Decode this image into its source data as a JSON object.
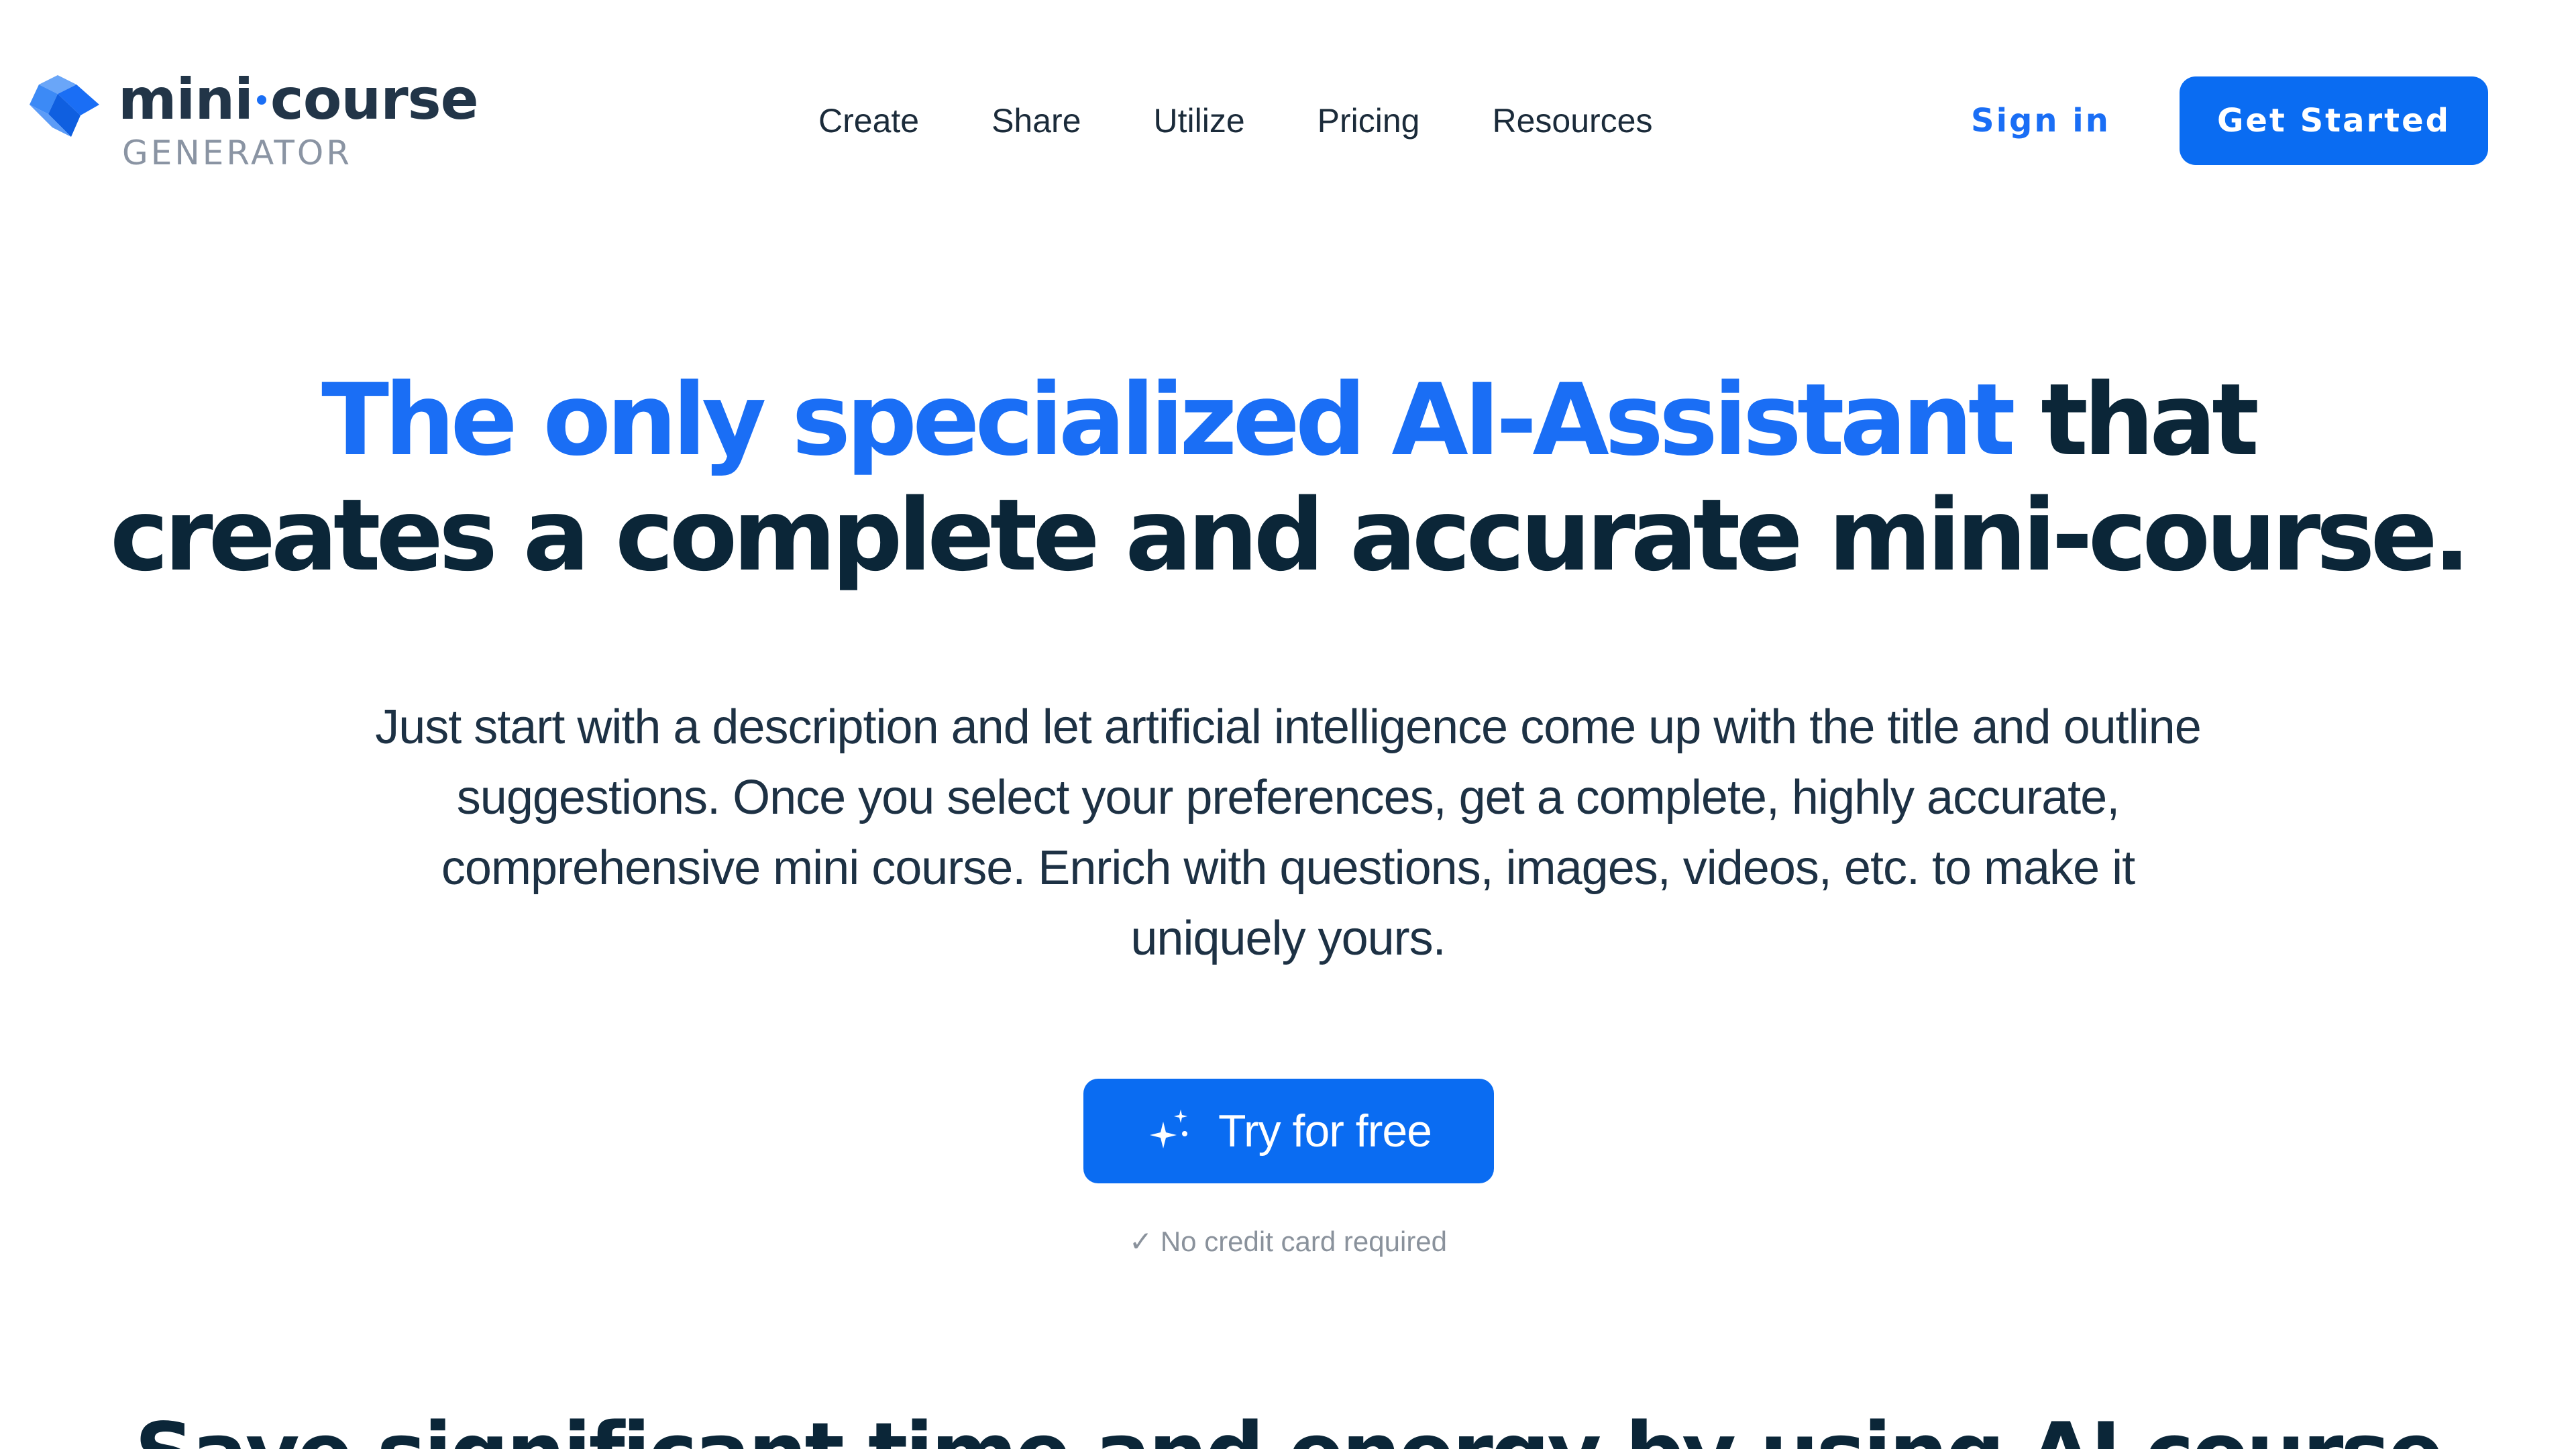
{
  "brand": {
    "name_left": "mini",
    "name_right": "course",
    "subtitle": "GENERATOR",
    "logo_icon": "diamond-logo-icon"
  },
  "nav": {
    "items": [
      {
        "label": "Create"
      },
      {
        "label": "Share"
      },
      {
        "label": "Utilize"
      },
      {
        "label": "Pricing"
      },
      {
        "label": "Resources"
      }
    ]
  },
  "auth": {
    "sign_in": "Sign in",
    "get_started": "Get Started"
  },
  "hero": {
    "title_accent": "The only specialized AI-Assistant",
    "title_rest_line1": " that",
    "title_line2": "creates a complete and accurate mini-course.",
    "description": "Just start with a description and let artificial intelligence come up with the title and outline suggestions. Once you select your preferences, get a complete, highly accurate, comprehensive mini course. Enrich with questions, images, videos, etc. to make it uniquely yours.",
    "cta_label": "Try for free",
    "cta_icon": "sparkle-icon",
    "note": "✓ No credit card required"
  },
  "next_section": {
    "heading": "Save significant time and energy by using AI course"
  },
  "colors": {
    "accent": "#1a6ef5",
    "button": "#0a6cf2",
    "heading": "#0b2638",
    "muted": "#8a929c"
  }
}
